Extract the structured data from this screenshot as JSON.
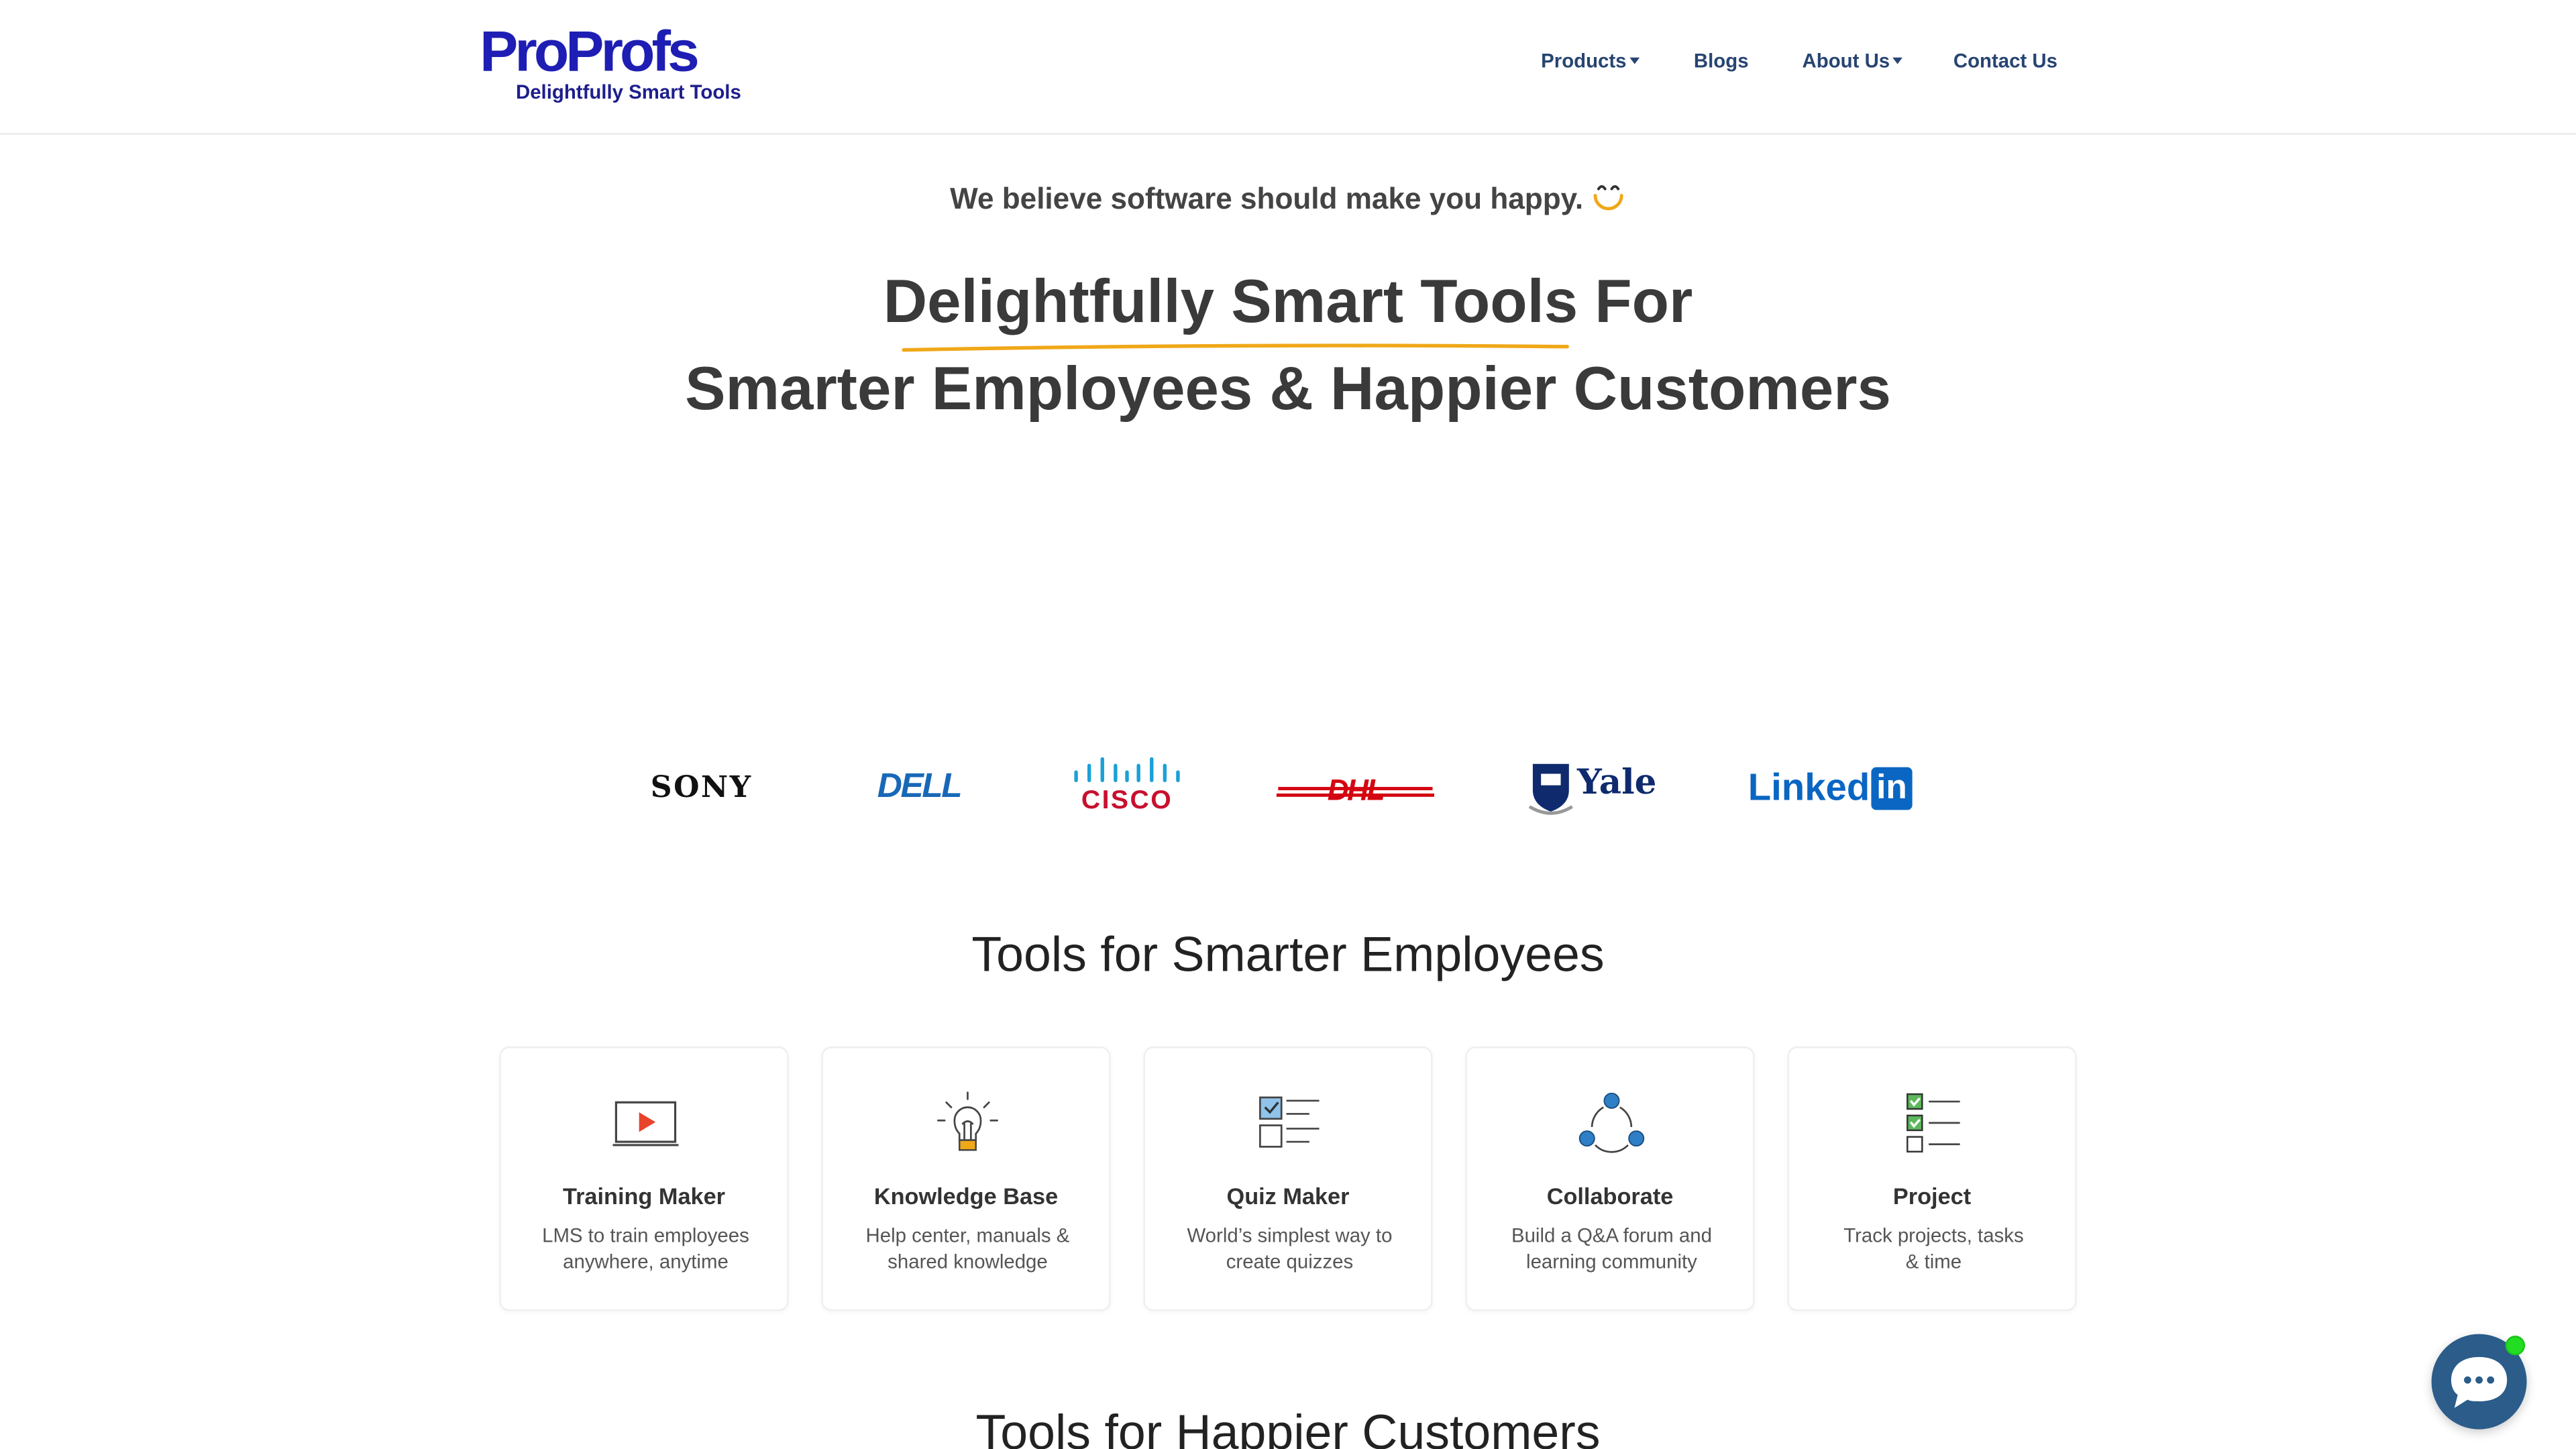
{
  "header": {
    "logo_main": "ProProfs",
    "logo_tagline": "Delightfully Smart Tools",
    "nav": [
      {
        "label": "Products",
        "dropdown": true
      },
      {
        "label": "Blogs",
        "dropdown": false
      },
      {
        "label": "About Us",
        "dropdown": true
      },
      {
        "label": "Contact Us",
        "dropdown": false
      }
    ]
  },
  "hero": {
    "tagline": "We believe software should make you happy.",
    "headline_line1": "Delightfully Smart Tools For",
    "headline_line2": "Smarter Employees & Happier Customers",
    "accent_color": "#f0a818"
  },
  "clients": {
    "sony": "SONY",
    "dell": "DELL",
    "cisco": "CISCO",
    "dhl": "DHL",
    "yale": "Yale",
    "linkedin_word": "Linked",
    "linkedin_box": "in"
  },
  "employees_section": {
    "title": "Tools for Smarter Employees",
    "cards": [
      {
        "icon": "video-play-icon",
        "title": "Training Maker",
        "desc_line1": "LMS to train employees",
        "desc_line2": "anywhere, anytime"
      },
      {
        "icon": "lightbulb-icon",
        "title": "Knowledge Base",
        "desc_line1": "Help center, manuals &",
        "desc_line2": "shared knowledge"
      },
      {
        "icon": "checklist-icon",
        "title": "Quiz Maker",
        "desc_line1": "World’s simplest way to",
        "desc_line2": "create quizzes"
      },
      {
        "icon": "network-icon",
        "title": "Collaborate",
        "desc_line1": "Build a Q&A forum and",
        "desc_line2": "learning community"
      },
      {
        "icon": "task-list-icon",
        "title": "Project",
        "desc_line1": "Track projects, tasks",
        "desc_line2": "& time"
      }
    ]
  },
  "customers_section": {
    "title": "Tools for Happier Customers"
  },
  "chat": {
    "icon": "chat-bubble-icon",
    "status_color": "#22dd22"
  }
}
